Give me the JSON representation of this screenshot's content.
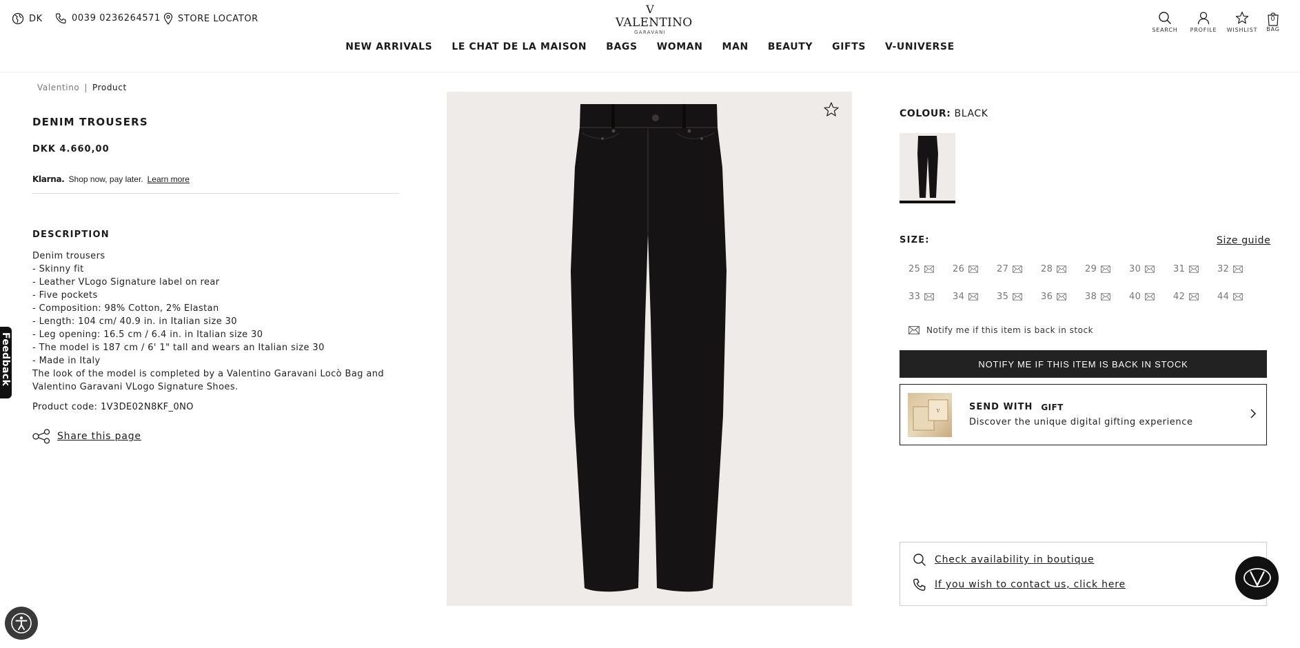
{
  "header": {
    "country": "DK",
    "phone": "0039 0236264571",
    "store_locator": "STORE LOCATOR",
    "logo": {
      "mark": "V",
      "word": "VALENTINO",
      "sub": "GARAVANI"
    },
    "actions": [
      {
        "label": "SEARCH",
        "icon": "search-icon"
      },
      {
        "label": "PROFILE",
        "icon": "profile-icon"
      },
      {
        "label": "WISHLIST",
        "icon": "star-icon"
      },
      {
        "label": "BAG",
        "icon": "bag-icon",
        "count": "0"
      }
    ],
    "nav": [
      "NEW ARRIVALS",
      "LE CHAT DE LA MAISON",
      "BAGS",
      "WOMAN",
      "MAN",
      "BEAUTY",
      "GIFTS",
      "V-UNIVERSE"
    ]
  },
  "breadcrumb": {
    "home": "Valentino",
    "separator": "|",
    "current": "Product"
  },
  "product": {
    "title": "DENIM TROUSERS",
    "price": "DKK 4.660,00",
    "klarna": {
      "logo": "Klarna.",
      "text": "Shop now, pay later.",
      "link": "Learn more"
    },
    "description_title": "DESCRIPTION",
    "description_lines": [
      "Denim trousers",
      "- Skinny fit",
      "- Leather VLogo Signature label on rear",
      "- Five pockets",
      "- Composition: 98% Cotton, 2% Elastan",
      "- Length: 104 cm/ 40.9 in. in Italian size 30",
      "- Leg opening: 16.5 cm / 6.4 in. in Italian size 30",
      "- The model is 187 cm / 6' 1\" tall and wears an Italian size 30",
      "- Made in Italy",
      "The look of the model is completed by a Valentino Garavani Locò Bag and Valentino Garavani VLogo Signature Shoes."
    ],
    "product_code": "Product code: 1V3DE02N8KF_0NO",
    "share": "Share this page"
  },
  "feedback": "Feedback",
  "colour": {
    "label": "COLOUR:",
    "value": "BLACK"
  },
  "size": {
    "label": "SIZE:",
    "guide": "Size guide",
    "options": [
      "25",
      "26",
      "27",
      "28",
      "29",
      "30",
      "31",
      "32",
      "33",
      "34",
      "35",
      "36",
      "38",
      "40",
      "42",
      "44"
    ],
    "notify_line": "Notify me if this item is back in stock",
    "notify_button": "NOTIFY ME IF THIS ITEM IS BACK IN STOCK"
  },
  "gift": {
    "title": "SEND WITH",
    "brand": "GIFT",
    "subtitle": "Discover the unique digital gifting experience"
  },
  "contact": {
    "availability": "Check availability in boutique",
    "contact_us": "If you wish to contact us, click here"
  },
  "colors": {
    "text": "#1b1b1b",
    "button_bg": "#222222",
    "image_bg": "#efebe9",
    "denim": "#151313"
  }
}
